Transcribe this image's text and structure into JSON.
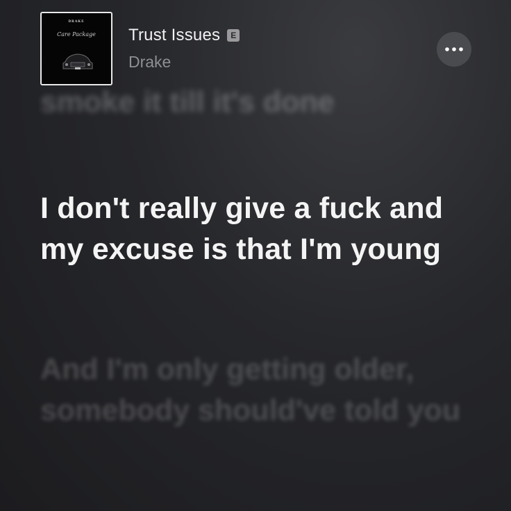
{
  "now_playing": {
    "title": "Trust Issues",
    "explicit_label": "E",
    "artist": "Drake",
    "more_icon": "ellipsis-icon",
    "album_art": {
      "artist_text": "DRAKE",
      "title_text": "Care Package"
    }
  },
  "lyrics": {
    "previous": "smoke it till it's done",
    "current": "I don't really give a fuck and my excuse is that I'm young",
    "next": "And I'm only getting older, somebody should've told you"
  }
}
